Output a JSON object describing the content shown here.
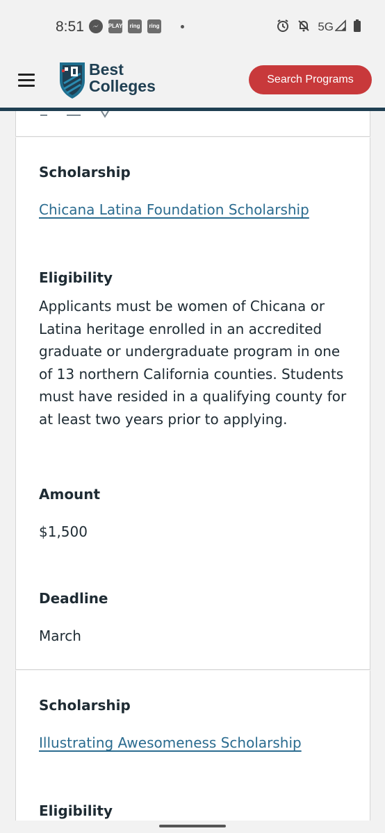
{
  "status_bar": {
    "time": "8:51",
    "notifications": [
      "messenger-icon",
      "play-together-icon",
      "ring-icon",
      "ring-icon"
    ],
    "notif_labels": {
      "play": "PLAY",
      "ring1": "ring",
      "ring2": "ring"
    },
    "network": "5G",
    "icons": [
      "alarm-icon",
      "bell-off-icon",
      "signal-icon",
      "battery-icon"
    ]
  },
  "header": {
    "logo_line1": "Best",
    "logo_line2": "Colleges",
    "search_button": "Search Programs",
    "accent_color": "#c8393b",
    "brand_color": "#1f3f52"
  },
  "scholarships": [
    {
      "scholarship_label": "Scholarship",
      "name": "Chicana Latina Foundation Scholarship",
      "eligibility_label": "Eligibility",
      "eligibility_lines": [
        "Applicants must be women of Chicana or",
        "Latina heritage enrolled in an accredited",
        "graduate or undergraduate program in one",
        "of 13 northern California counties. Students",
        "must have resided in a qualifying county for",
        "at least two years prior to applying."
      ],
      "amount_label": "Amount",
      "amount": "$1,500",
      "deadline_label": "Deadline",
      "deadline": "March"
    },
    {
      "scholarship_label": "Scholarship",
      "name": "Illustrating Awesomeness Scholarship",
      "eligibility_label": "Eligibility"
    }
  ],
  "link_color": "#2a6b8f"
}
